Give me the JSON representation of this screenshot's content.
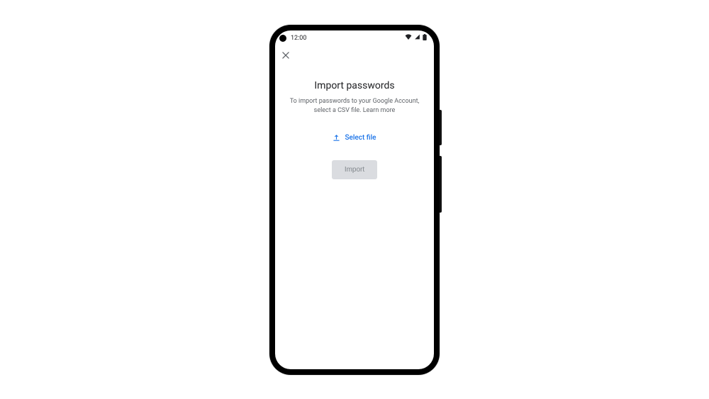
{
  "statusbar": {
    "time": "12:00"
  },
  "page": {
    "title": "Import passwords",
    "subtitle": "To import passwords to your Google Account, select a CSV file. Learn more",
    "select_file_label": "Select file",
    "import_button_label": "Import"
  }
}
